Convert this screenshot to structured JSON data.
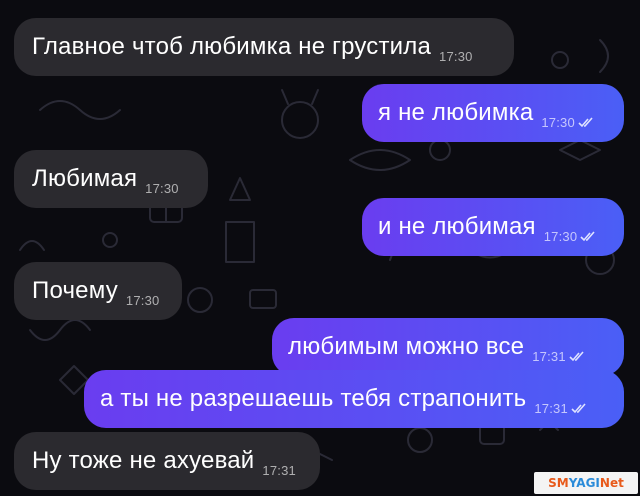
{
  "messages": [
    {
      "dir": "in",
      "text": "Главное чтоб любимка не грустила",
      "time": "17:30",
      "read": false
    },
    {
      "dir": "out",
      "text": "я не любимка",
      "time": "17:30",
      "read": true
    },
    {
      "dir": "in",
      "text": "Любимая",
      "time": "17:30",
      "read": false
    },
    {
      "dir": "out",
      "text": "и не любимая",
      "time": "17:30",
      "read": true
    },
    {
      "dir": "in",
      "text": "Почему",
      "time": "17:30",
      "read": false
    },
    {
      "dir": "out",
      "text": "любимым можно все",
      "time": "17:31",
      "read": true
    },
    {
      "dir": "out",
      "text": "а ты не разрешаешь тебя страпонить",
      "time": "17:31",
      "read": true
    },
    {
      "dir": "in",
      "text": "Ну тоже не ахуевай",
      "time": "17:31",
      "read": false
    }
  ],
  "watermark": {
    "text": "SMYAGINet"
  },
  "colors": {
    "incoming": "#2b2a2f",
    "outgoing_start": "#6a3df0",
    "outgoing_end": "#4a5ff6",
    "background": "#0b0b10"
  }
}
